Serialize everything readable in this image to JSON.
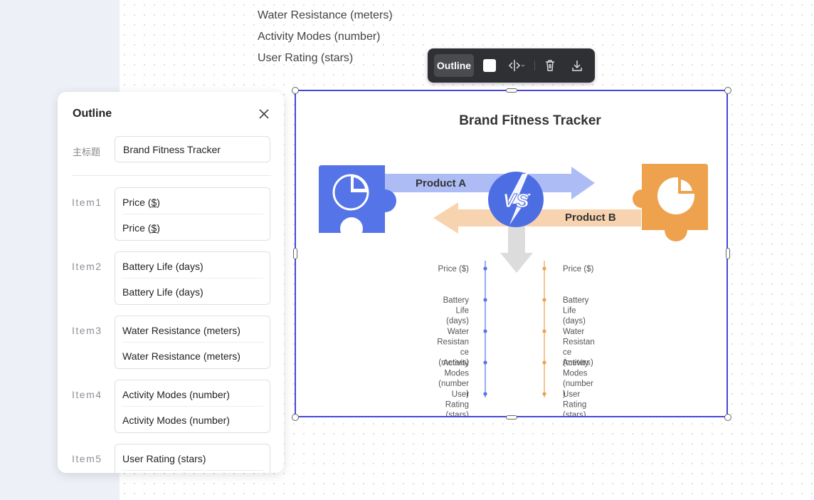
{
  "background_list": [
    "Water Resistance (meters)",
    "Activity Modes (number)",
    "User Rating (stars)"
  ],
  "toolbar": {
    "outline_label": "Outline",
    "fill_color": "#ffffff",
    "icons": [
      "color-swatch-icon",
      "align-split-icon",
      "trash-icon",
      "download-icon"
    ]
  },
  "panel": {
    "title": "Outline",
    "main_title_label": "主标题",
    "main_title_value": "Brand Fitness Tracker",
    "items": [
      {
        "label": "Item1",
        "a": "Price (",
        "a_u": "$",
        "a_end": ")",
        "b": "Price (",
        "b_u": "$",
        "b_end": ")"
      },
      {
        "label": "Item2",
        "a": "Battery Life (days)",
        "b": "Battery Life (days)"
      },
      {
        "label": "Item3",
        "a": "Water Resistance (meters)",
        "b": "Water Resistance (meters)"
      },
      {
        "label": "Item4",
        "a": "Activity Modes (number)",
        "b": "Activity Modes (number)"
      },
      {
        "label": "Item5",
        "a": "User Rating (stars)"
      }
    ]
  },
  "infographic": {
    "title": "Brand Fitness Tracker",
    "vs_text": "VS",
    "product_a": "Product A",
    "product_b": "Product B",
    "color_a": "#5474e8",
    "color_b": "#eea24e",
    "a_items": [
      [
        "Price ($)"
      ],
      [
        "Battery",
        "Life",
        "(days)"
      ],
      [
        "Water",
        "Resistan",
        "ce",
        "(meters)"
      ],
      [
        "Activity",
        "Modes",
        "(number",
        ")"
      ],
      [
        "User",
        "Rating",
        "(stars)"
      ]
    ],
    "b_items": [
      [
        "Price ($)"
      ],
      [
        "Battery",
        "Life",
        "(days)"
      ],
      [
        "Water",
        "Resistan",
        "ce",
        "(meters)"
      ],
      [
        "Activity",
        "Modes",
        "(number",
        ")"
      ],
      [
        "User",
        "Rating",
        "(stars)"
      ]
    ]
  }
}
